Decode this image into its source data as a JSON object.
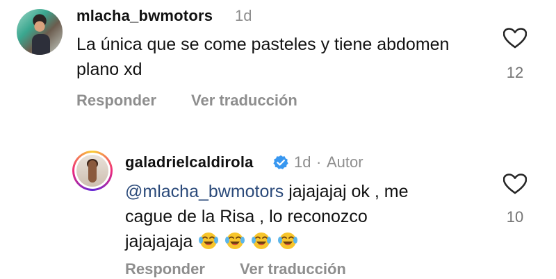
{
  "comments": [
    {
      "username": "mlacha_bwmotors",
      "time": "1d",
      "text": "La única que se come pasteles y tiene abdomen plano xd",
      "likes": "12",
      "reply_label": "Responder",
      "translate_label": "Ver traducción",
      "avatar_icon": "profile-photo"
    },
    {
      "username": "galadrielcaldirola",
      "verified": true,
      "time": "1d",
      "separator": "·",
      "author_badge": "Autor",
      "mention": "@mlacha_bwmotors",
      "text_line1": " jajajajaj ok , me",
      "text_line2": "cague de la Risa , lo reconozco",
      "text_line3": "jajajajaja",
      "emoji": [
        "face-with-tears-of-joy",
        "face-with-tears-of-joy",
        "face-with-tears-of-joy",
        "face-with-tears-of-joy"
      ],
      "likes": "10",
      "reply_label": "Responder",
      "translate_label": "Ver traducción",
      "avatar_icon": "story-ring-profile-photo"
    }
  ],
  "colors": {
    "text": "#111111",
    "muted": "#8e8e8e",
    "mention": "#2b4a7a",
    "verified": "#3897f0"
  }
}
